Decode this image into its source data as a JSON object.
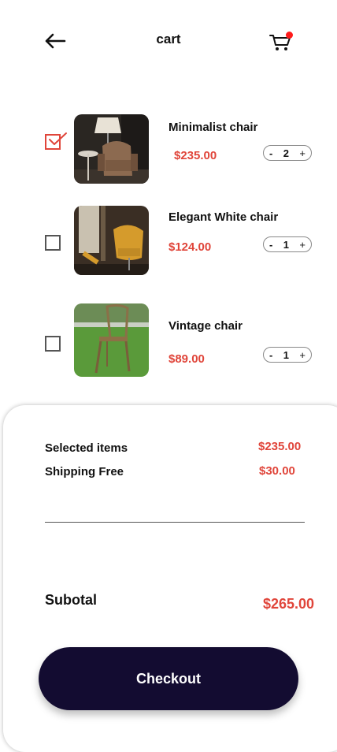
{
  "header": {
    "title": "cart",
    "back_icon": "arrow-left-icon",
    "cart_icon": "shopping-cart-icon",
    "notification_color": "#ff1b1b"
  },
  "items": [
    {
      "name": "Minimalist chair",
      "price": "$235.00",
      "quantity": "2",
      "selected": true,
      "image": "armchair-with-lamp"
    },
    {
      "name": "Elegant White chair",
      "price": "$124.00",
      "quantity": "1",
      "selected": false,
      "image": "yellow-egg-chair"
    },
    {
      "name": "Vintage chair",
      "price": "$89.00",
      "quantity": "1",
      "selected": false,
      "image": "wooden-chair-on-grass"
    }
  ],
  "stepper": {
    "minus": "-",
    "plus": "+"
  },
  "summary": {
    "selected_items_label": "Selected items",
    "selected_items_value": "$235.00",
    "shipping_label": "Shipping Free",
    "shipping_value": "$30.00",
    "subtotal_label": "Subotal",
    "subtotal_value": "$265.00"
  },
  "checkout": {
    "label": "Checkout"
  },
  "colors": {
    "accent": "#e0453a",
    "button_bg": "#130c31",
    "checkbox_checked": "#e0453a"
  }
}
